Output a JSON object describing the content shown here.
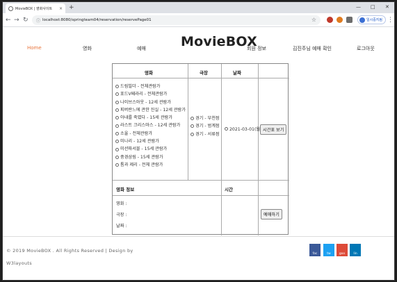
{
  "browser": {
    "tab_title": "MovieBOX | 영화사이트",
    "tab_close": "×",
    "new_tab": "+",
    "url": "localhost:8080/springteam04/reservation/reservePage01",
    "profile_label": "일시중지됨",
    "window_min": "—",
    "window_max": "□",
    "window_close": "✕"
  },
  "nav": {
    "home": "Home",
    "movies": "영화",
    "reserve": "예매",
    "logo": "MovieBOX",
    "member_info": "회원 정보",
    "my_reservations": "김진주님 예매 확인",
    "logout": "로그아웃"
  },
  "table": {
    "headers": {
      "movie": "영화",
      "theater": "극장",
      "date": "날짜",
      "movie_info": "영화 정보",
      "time": "시간"
    },
    "movies": [
      "드림빌더 - 전체관람가",
      "포드V페라리 - 전체관람가",
      "나이브스아웃 - 12세 관람가",
      "피버란느에 관한 진실 - 12세 관람가",
      "아내를 죽였다 - 15세 관람가",
      "라스트 크리스마스 - 12세 관람가",
      "소울 - 전체관람가",
      "미나리 - 12세 관람가",
      "미션파서블 - 15세 관람가",
      "중경삼림 - 15세 관람가",
      "톰과 제리 - 전체 관람가"
    ],
    "theaters": [
      "경기 - 부천점",
      "경기 - 범계점",
      "경기 - 서류점"
    ],
    "date": "2021-03-01(월)",
    "timetable_button": "시간표 보기",
    "info_labels": {
      "movie": "영화 :",
      "theater": "극장 :",
      "date": "날짜 :"
    },
    "reserve_button": "예매하기"
  },
  "footer": {
    "copyright_line1": "© 2019 MovieBOX . All Rights Reserved | Design by",
    "copyright_line2": "W3layouts",
    "social": [
      "fac",
      "tw",
      "goo",
      "lin"
    ],
    "social_colors": [
      "#3b5998",
      "#1da1f2",
      "#dd4b39",
      "#0077b5"
    ]
  }
}
